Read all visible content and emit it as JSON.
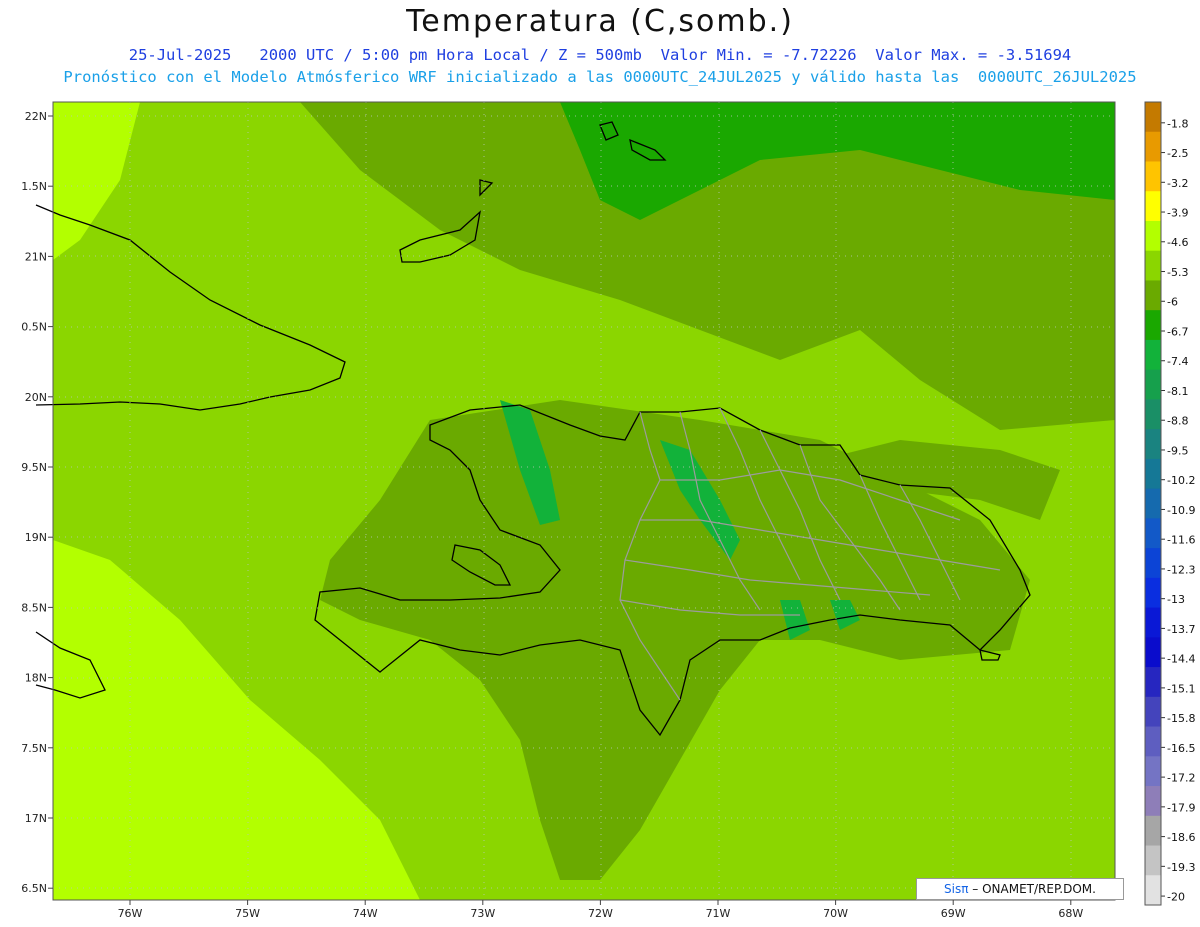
{
  "header": {
    "title": "Temperatura (C,somb.)",
    "line1": "25-Jul-2025   2000 UTC / 5:00 pm Hora Local / Z = 500mb  Valor Min. = -7.72226  Valor Max. = -3.51694",
    "line2": "Pronóstico con el Modelo Atmósferico WRF inicializado a las 0000UTC_24JUL2025 y válido hasta las  0000UTC_26JUL2025"
  },
  "axes": {
    "lat_labels": [
      "22N",
      "1.5N",
      "21N",
      "0.5N",
      "20N",
      "9.5N",
      "19N",
      "8.5N",
      "18N",
      "7.5N",
      "17N",
      "6.5N"
    ],
    "lon_labels": [
      "76W",
      "75W",
      "74W",
      "73W",
      "72W",
      "71W",
      "70W",
      "69W",
      "68W"
    ]
  },
  "colorbar": {
    "levels": [
      {
        "label": "-1.8",
        "color": "#c47a00"
      },
      {
        "label": "-2.5",
        "color": "#e89a00"
      },
      {
        "label": "-3.2",
        "color": "#ffc400"
      },
      {
        "label": "-3.9",
        "color": "#ffff00"
      },
      {
        "label": "-4.6",
        "color": "#b3ff00"
      },
      {
        "label": "-5.3",
        "color": "#8bd600"
      },
      {
        "label": "-6",
        "color": "#6aaa00"
      },
      {
        "label": "-6.7",
        "color": "#1aa800"
      },
      {
        "label": "-7.4",
        "color": "#12b23a"
      },
      {
        "label": "-8.1",
        "color": "#16a04c"
      },
      {
        "label": "-8.8",
        "color": "#1a8f66"
      },
      {
        "label": "-9.5",
        "color": "#1a8380"
      },
      {
        "label": "-10.2",
        "color": "#157896"
      },
      {
        "label": "-10.9",
        "color": "#156aae"
      },
      {
        "label": "-11.6",
        "color": "#1259c8"
      },
      {
        "label": "-12.3",
        "color": "#0c44d6"
      },
      {
        "label": "-13",
        "color": "#0a2ee0"
      },
      {
        "label": "-13.7",
        "color": "#0a18d6"
      },
      {
        "label": "-14.4",
        "color": "#0a0ccc"
      },
      {
        "label": "-15.1",
        "color": "#2626c0"
      },
      {
        "label": "-15.8",
        "color": "#4444bc"
      },
      {
        "label": "-16.5",
        "color": "#5e5ec0"
      },
      {
        "label": "-17.2",
        "color": "#7474c4"
      },
      {
        "label": "-17.9",
        "color": "#8e7eb8"
      },
      {
        "label": "-18.6",
        "color": "#a6a6a6"
      },
      {
        "label": "-19.3",
        "color": "#c4c4c4"
      },
      {
        "label": "-20",
        "color": "#e2e2e2"
      }
    ]
  },
  "credit": {
    "brand": "Sisπ",
    "text": "– ONAMET/REP.DOM."
  }
}
